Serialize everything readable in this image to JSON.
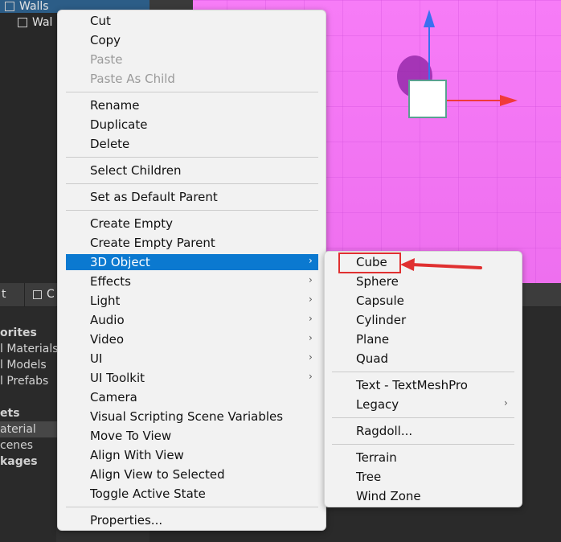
{
  "hierarchy": {
    "rows": [
      {
        "label": "Walls",
        "selected": true
      },
      {
        "label": "Wal",
        "selected": false
      }
    ]
  },
  "bottom_tabs": {
    "tab1": "t",
    "tab2": "C"
  },
  "project": {
    "items": [
      {
        "label": "orites",
        "bold": true
      },
      {
        "label": "l Materials",
        "bold": false
      },
      {
        "label": "l Models",
        "bold": false
      },
      {
        "label": "l Prefabs",
        "bold": false
      },
      {
        "label": "ets",
        "bold": true
      },
      {
        "label": "aterial",
        "bold": false,
        "selected": true
      },
      {
        "label": "cenes",
        "bold": false
      },
      {
        "label": "kages",
        "bold": true
      }
    ]
  },
  "context_menu": {
    "items": [
      {
        "label": "Cut",
        "disabled": false
      },
      {
        "label": "Copy",
        "disabled": false
      },
      {
        "label": "Paste",
        "disabled": true
      },
      {
        "label": "Paste As Child",
        "disabled": true
      },
      {
        "label": "Rename",
        "disabled": false
      },
      {
        "label": "Duplicate",
        "disabled": false
      },
      {
        "label": "Delete",
        "disabled": false
      },
      {
        "label": "Select Children",
        "disabled": false
      },
      {
        "label": "Set as Default Parent",
        "disabled": false
      },
      {
        "label": "Create Empty",
        "disabled": false
      },
      {
        "label": "Create Empty Parent",
        "disabled": false
      },
      {
        "label": "3D Object",
        "disabled": false,
        "submenu": true,
        "highlighted": true
      },
      {
        "label": "Effects",
        "submenu": true
      },
      {
        "label": "Light",
        "submenu": true
      },
      {
        "label": "Audio",
        "submenu": true
      },
      {
        "label": "Video",
        "submenu": true
      },
      {
        "label": "UI",
        "submenu": true
      },
      {
        "label": "UI Toolkit",
        "submenu": true
      },
      {
        "label": "Camera"
      },
      {
        "label": "Visual Scripting Scene Variables"
      },
      {
        "label": "Move To View"
      },
      {
        "label": "Align With View"
      },
      {
        "label": "Align View to Selected"
      },
      {
        "label": "Toggle Active State"
      },
      {
        "label": "Properties..."
      }
    ]
  },
  "submenu_3d_object": {
    "items": [
      {
        "label": "Cube",
        "annotated": true
      },
      {
        "label": "Sphere"
      },
      {
        "label": "Capsule"
      },
      {
        "label": "Cylinder"
      },
      {
        "label": "Plane"
      },
      {
        "label": "Quad"
      },
      {
        "label": "Text - TextMeshPro"
      },
      {
        "label": "Legacy",
        "submenu": true
      },
      {
        "label": "Ragdoll..."
      },
      {
        "label": "Terrain"
      },
      {
        "label": "Tree"
      },
      {
        "label": "Wind Zone"
      }
    ]
  },
  "icons": {
    "submenu_arrow": "chevron-right-icon",
    "gameobject": "cube-icon"
  },
  "colors": {
    "menu_highlight": "#0b79d0",
    "annotation": "#e03030",
    "scene_bg": "#f77cf7",
    "gizmo_y": "#3a6ff0",
    "gizmo_x": "#f03a3a"
  }
}
